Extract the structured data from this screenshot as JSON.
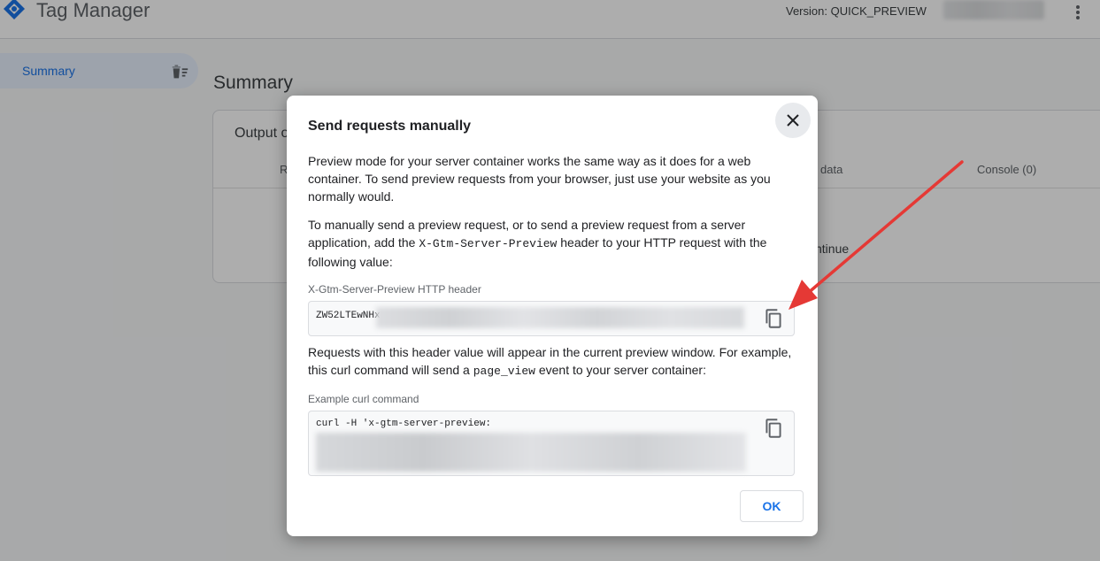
{
  "header": {
    "app_title": "Tag Manager",
    "version_label": "Version: QUICK_PREVIEW"
  },
  "sidebar": {
    "items": [
      {
        "label": "Summary"
      }
    ]
  },
  "main": {
    "title": "Summary",
    "card": {
      "header": "Output o",
      "tabs": [
        "R",
        "data",
        "Console (0)"
      ],
      "partial_text": "ntinue"
    }
  },
  "dialog": {
    "title": "Send requests manually",
    "paragraph1": "Preview mode for your server container works the same way as it does for a web container. To send preview requests from your browser, just use your website as you normally would.",
    "paragraph2_a": "To manually send a preview request, or to send a preview request from a server application, add the ",
    "paragraph2_code": "X-Gtm-Server-Preview",
    "paragraph2_b": " header to your HTTP request with the following value:",
    "header_field": {
      "label": "X-Gtm-Server-Preview HTTP header",
      "value": "ZW52LTEwNHx"
    },
    "paragraph3_a": "Requests with this header value will appear in the current preview window. For example, this curl command will send a ",
    "paragraph3_code": "page_view",
    "paragraph3_b": " event to your server container:",
    "curl_field": {
      "label": "Example curl command",
      "value": "curl -H 'x-gtm-server-preview:"
    },
    "ok_label": "OK"
  },
  "colors": {
    "brand_blue": "#1a73e8",
    "annotation_arrow": "#e53935"
  },
  "icons": {
    "close": "close-icon",
    "copy": "copy-icon",
    "logo": "tag-manager-logo-icon",
    "delete": "delete-sweep-icon",
    "menu": "more-vert-icon"
  }
}
